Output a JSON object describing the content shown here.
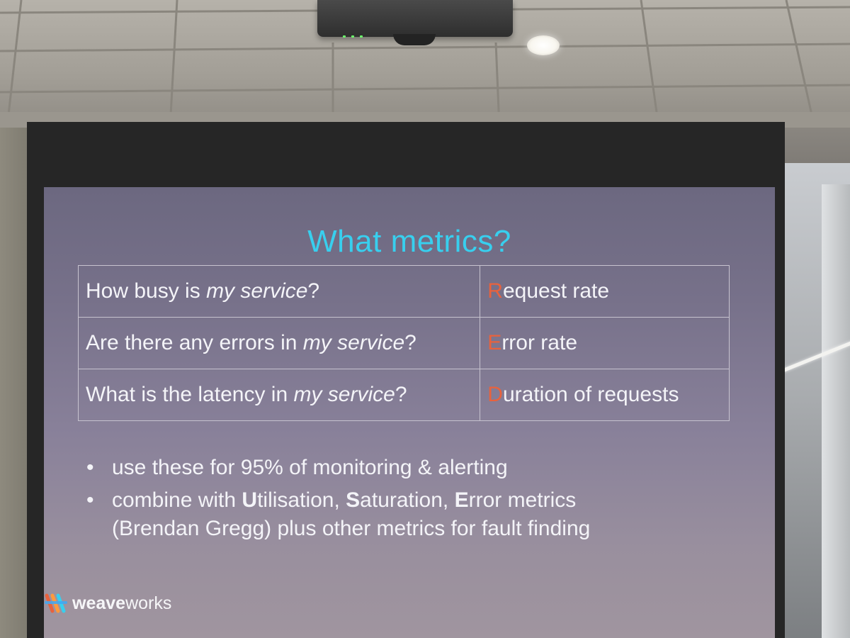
{
  "slide": {
    "title": "What metrics?",
    "table": [
      {
        "q_before": "How busy is ",
        "q_em": "my service",
        "q_after": "?",
        "a_initial": "R",
        "a_rest": "equest rate"
      },
      {
        "q_before": "Are there any errors in ",
        "q_em": "my service",
        "q_after": "?",
        "a_initial": "E",
        "a_rest": "rror rate"
      },
      {
        "q_before": "What is the latency in ",
        "q_em": "my service",
        "q_after": "?",
        "a_initial": "D",
        "a_rest": "uration of requests"
      }
    ],
    "bullets": {
      "first": "use these for 95% of monitoring & alerting",
      "second_prefix": "combine with ",
      "u_bold": "U",
      "u_rest": "tilisation, ",
      "s_bold": "S",
      "s_rest": "aturation, ",
      "e_bold": "E",
      "e_rest": "rror metrics",
      "second_line2": "(Brendan Gregg) plus other metrics for fault finding",
      "marker": "•"
    },
    "logo": {
      "bold": "weave",
      "light": "works"
    },
    "accent_color": "#38cfee",
    "highlight_color": "#e8623d"
  }
}
